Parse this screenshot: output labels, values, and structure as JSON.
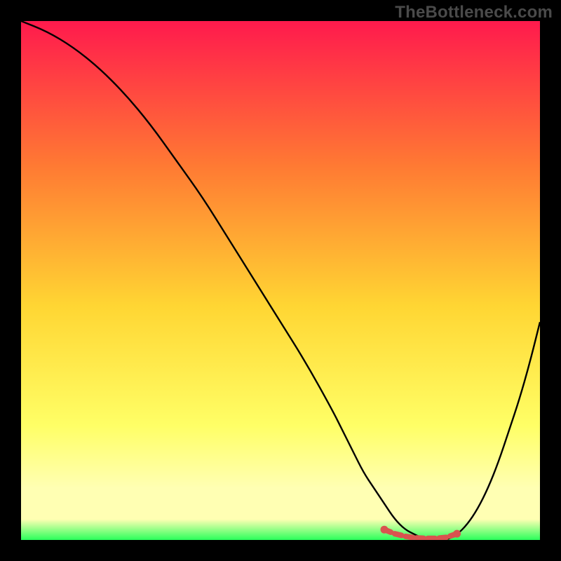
{
  "watermark": "TheBottleneck.com",
  "colors": {
    "bg": "#000000",
    "grad_top": "#ff1a4d",
    "grad_mid1": "#ff7a33",
    "grad_mid2": "#ffd633",
    "grad_low": "#ffff66",
    "grad_pale": "#ffffb3",
    "grad_bottom": "#2aff5a",
    "curve": "#000000",
    "marker": "#d9534f"
  },
  "chart_data": {
    "type": "line",
    "title": "",
    "xlabel": "",
    "ylabel": "",
    "ylim": [
      0,
      100
    ],
    "xlim": [
      0,
      100
    ],
    "series": [
      {
        "name": "bottleneck-curve",
        "x": [
          0,
          5,
          10,
          15,
          20,
          25,
          30,
          35,
          40,
          45,
          50,
          55,
          60,
          62,
          64,
          66,
          68,
          70,
          72,
          74,
          76,
          78,
          80,
          82,
          84,
          86,
          88,
          90,
          92,
          94,
          96,
          98,
          100
        ],
        "y": [
          100,
          98,
          95,
          91,
          86,
          80,
          73,
          66,
          58,
          50,
          42,
          34,
          25,
          21,
          17,
          13,
          10,
          7,
          4,
          2,
          1,
          0,
          0,
          0,
          1,
          3,
          6,
          10,
          15,
          21,
          27,
          34,
          42
        ]
      }
    ],
    "markers": {
      "name": "optimal-zone",
      "x": [
        70,
        72,
        74,
        76,
        78,
        80,
        82,
        84
      ],
      "y": [
        2,
        1.2,
        0.7,
        0.4,
        0.3,
        0.3,
        0.5,
        1.2
      ]
    }
  }
}
